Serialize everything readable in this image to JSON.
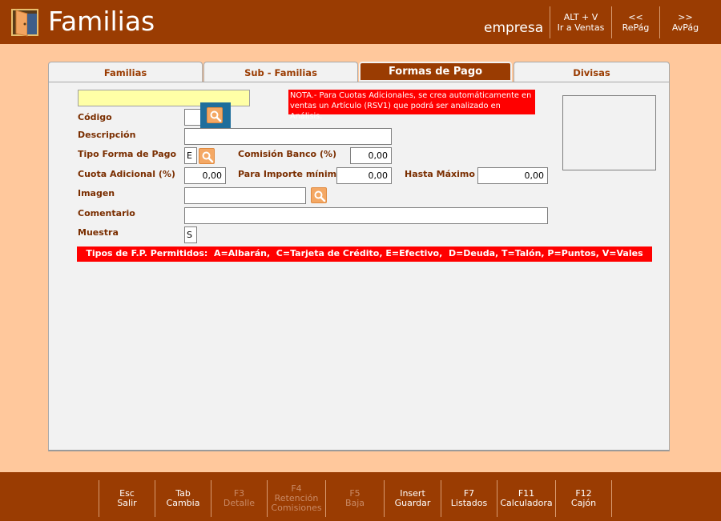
{
  "header": {
    "title": "Familias",
    "company": "empresa",
    "buttons": [
      {
        "line1": "ALT + V",
        "line2": "Ir a Ventas"
      },
      {
        "line1": "<<",
        "line2": "RePág"
      },
      {
        "line1": ">>",
        "line2": "AvPág"
      }
    ]
  },
  "tabs": [
    {
      "label": "Familias"
    },
    {
      "label": "Sub - Familias"
    },
    {
      "label": "Formas de Pago"
    },
    {
      "label": "Divisas"
    }
  ],
  "form": {
    "search_value": "",
    "codigo_label": "Código",
    "codigo_value": "",
    "descripcion_label": "Descripción",
    "descripcion_value": "",
    "tipo_label": "Tipo Forma de Pago",
    "tipo_value": "E",
    "comision_label": "Comisión Banco (%)",
    "comision_value": "0,00",
    "cuota_label": "Cuota Adicional (%)",
    "cuota_value": "0,00",
    "importe_label": "Para Importe mínimo",
    "importe_value": "0,00",
    "hasta_label": "Hasta Máximo",
    "hasta_value": "0,00",
    "imagen_label": "Imagen",
    "imagen_value": "",
    "comentario_label": "Comentario",
    "comentario_value": "",
    "muestra_label": "Muestra",
    "muestra_value": "S"
  },
  "note": "NOTA.- Para Cuotas Adicionales, se crea automáticamente en ventas un Artículo (RSV1) que podrá ser analizado en Análisis.",
  "types_bar": "Tipos de F.P. Permitidos:  A=Albarán,  C=Tarjeta de Crédito, E=Efectivo,  D=Deuda, T=Talón, P=Puntos, V=Vales",
  "footer": {
    "keys": [
      {
        "key": "Esc",
        "lines": [
          "Salir"
        ]
      },
      {
        "key": "Tab",
        "lines": [
          "Cambia"
        ]
      },
      {
        "key": "F3",
        "lines": [
          "Detalle"
        ]
      },
      {
        "key": "F4",
        "lines": [
          "Retención",
          "Comisiones"
        ]
      },
      {
        "key": "F5",
        "lines": [
          "Baja"
        ]
      },
      {
        "key": "Insert",
        "lines": [
          "Guardar"
        ]
      },
      {
        "key": "F7",
        "lines": [
          "Listados"
        ]
      },
      {
        "key": "F11",
        "lines": [
          "Calculadora"
        ]
      },
      {
        "key": "F12",
        "lines": [
          "Cajón"
        ]
      }
    ]
  },
  "icons": {
    "logo": "open-door-icon",
    "search": "magnifier-icon"
  },
  "colors": {
    "brand": "#9A3C02",
    "background": "#FFC89C",
    "panel": "#F2F2F2",
    "label": "#7A2E00",
    "alert": "#FF0000",
    "highlight": "#FFFFA6",
    "focus": "#1F6E9C",
    "icon_button": "#F4A864"
  }
}
